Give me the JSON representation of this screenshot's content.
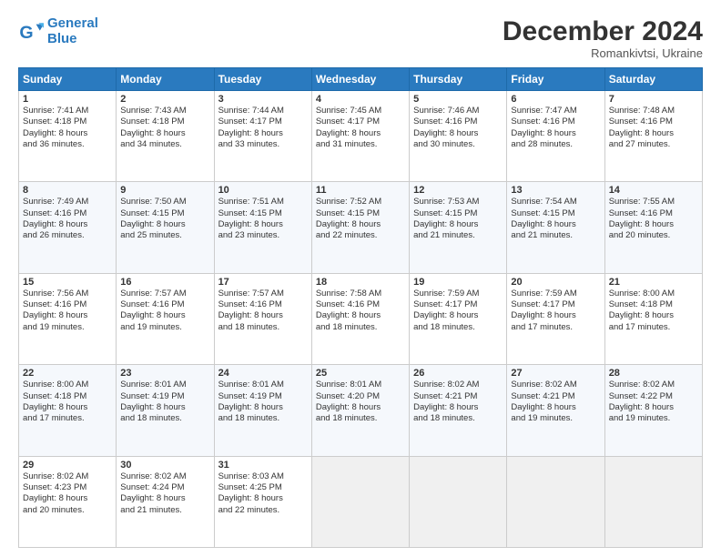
{
  "logo": {
    "line1": "General",
    "line2": "Blue"
  },
  "title": "December 2024",
  "subtitle": "Romankivtsi, Ukraine",
  "days_of_week": [
    "Sunday",
    "Monday",
    "Tuesday",
    "Wednesday",
    "Thursday",
    "Friday",
    "Saturday"
  ],
  "weeks": [
    [
      {
        "day": 1,
        "info": "Sunrise: 7:41 AM\nSunset: 4:18 PM\nDaylight: 8 hours\nand 36 minutes."
      },
      {
        "day": 2,
        "info": "Sunrise: 7:43 AM\nSunset: 4:18 PM\nDaylight: 8 hours\nand 34 minutes."
      },
      {
        "day": 3,
        "info": "Sunrise: 7:44 AM\nSunset: 4:17 PM\nDaylight: 8 hours\nand 33 minutes."
      },
      {
        "day": 4,
        "info": "Sunrise: 7:45 AM\nSunset: 4:17 PM\nDaylight: 8 hours\nand 31 minutes."
      },
      {
        "day": 5,
        "info": "Sunrise: 7:46 AM\nSunset: 4:16 PM\nDaylight: 8 hours\nand 30 minutes."
      },
      {
        "day": 6,
        "info": "Sunrise: 7:47 AM\nSunset: 4:16 PM\nDaylight: 8 hours\nand 28 minutes."
      },
      {
        "day": 7,
        "info": "Sunrise: 7:48 AM\nSunset: 4:16 PM\nDaylight: 8 hours\nand 27 minutes."
      }
    ],
    [
      {
        "day": 8,
        "info": "Sunrise: 7:49 AM\nSunset: 4:16 PM\nDaylight: 8 hours\nand 26 minutes."
      },
      {
        "day": 9,
        "info": "Sunrise: 7:50 AM\nSunset: 4:15 PM\nDaylight: 8 hours\nand 25 minutes."
      },
      {
        "day": 10,
        "info": "Sunrise: 7:51 AM\nSunset: 4:15 PM\nDaylight: 8 hours\nand 23 minutes."
      },
      {
        "day": 11,
        "info": "Sunrise: 7:52 AM\nSunset: 4:15 PM\nDaylight: 8 hours\nand 22 minutes."
      },
      {
        "day": 12,
        "info": "Sunrise: 7:53 AM\nSunset: 4:15 PM\nDaylight: 8 hours\nand 21 minutes."
      },
      {
        "day": 13,
        "info": "Sunrise: 7:54 AM\nSunset: 4:15 PM\nDaylight: 8 hours\nand 21 minutes."
      },
      {
        "day": 14,
        "info": "Sunrise: 7:55 AM\nSunset: 4:16 PM\nDaylight: 8 hours\nand 20 minutes."
      }
    ],
    [
      {
        "day": 15,
        "info": "Sunrise: 7:56 AM\nSunset: 4:16 PM\nDaylight: 8 hours\nand 19 minutes."
      },
      {
        "day": 16,
        "info": "Sunrise: 7:57 AM\nSunset: 4:16 PM\nDaylight: 8 hours\nand 19 minutes."
      },
      {
        "day": 17,
        "info": "Sunrise: 7:57 AM\nSunset: 4:16 PM\nDaylight: 8 hours\nand 18 minutes."
      },
      {
        "day": 18,
        "info": "Sunrise: 7:58 AM\nSunset: 4:16 PM\nDaylight: 8 hours\nand 18 minutes."
      },
      {
        "day": 19,
        "info": "Sunrise: 7:59 AM\nSunset: 4:17 PM\nDaylight: 8 hours\nand 18 minutes."
      },
      {
        "day": 20,
        "info": "Sunrise: 7:59 AM\nSunset: 4:17 PM\nDaylight: 8 hours\nand 17 minutes."
      },
      {
        "day": 21,
        "info": "Sunrise: 8:00 AM\nSunset: 4:18 PM\nDaylight: 8 hours\nand 17 minutes."
      }
    ],
    [
      {
        "day": 22,
        "info": "Sunrise: 8:00 AM\nSunset: 4:18 PM\nDaylight: 8 hours\nand 17 minutes."
      },
      {
        "day": 23,
        "info": "Sunrise: 8:01 AM\nSunset: 4:19 PM\nDaylight: 8 hours\nand 18 minutes."
      },
      {
        "day": 24,
        "info": "Sunrise: 8:01 AM\nSunset: 4:19 PM\nDaylight: 8 hours\nand 18 minutes."
      },
      {
        "day": 25,
        "info": "Sunrise: 8:01 AM\nSunset: 4:20 PM\nDaylight: 8 hours\nand 18 minutes."
      },
      {
        "day": 26,
        "info": "Sunrise: 8:02 AM\nSunset: 4:21 PM\nDaylight: 8 hours\nand 18 minutes."
      },
      {
        "day": 27,
        "info": "Sunrise: 8:02 AM\nSunset: 4:21 PM\nDaylight: 8 hours\nand 19 minutes."
      },
      {
        "day": 28,
        "info": "Sunrise: 8:02 AM\nSunset: 4:22 PM\nDaylight: 8 hours\nand 19 minutes."
      }
    ],
    [
      {
        "day": 29,
        "info": "Sunrise: 8:02 AM\nSunset: 4:23 PM\nDaylight: 8 hours\nand 20 minutes."
      },
      {
        "day": 30,
        "info": "Sunrise: 8:02 AM\nSunset: 4:24 PM\nDaylight: 8 hours\nand 21 minutes."
      },
      {
        "day": 31,
        "info": "Sunrise: 8:03 AM\nSunset: 4:25 PM\nDaylight: 8 hours\nand 22 minutes."
      },
      null,
      null,
      null,
      null
    ]
  ]
}
